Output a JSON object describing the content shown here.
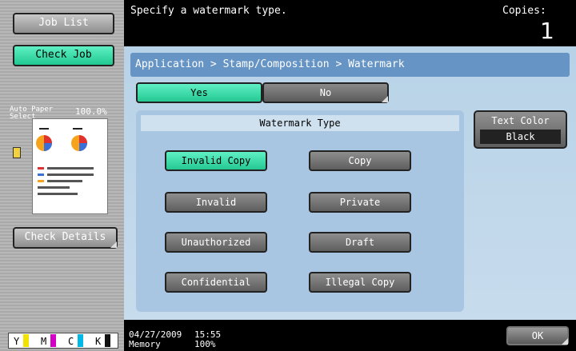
{
  "left": {
    "job_list": "Job List",
    "check_job": "Check Job",
    "auto_paper": "Auto Paper Select",
    "zoom": "100.0%",
    "check_details": "Check Details",
    "toner": [
      "Y",
      "M",
      "C",
      "K"
    ]
  },
  "header": {
    "instruction": "Specify a watermark type.",
    "copies_label": "Copies:",
    "copies_count": "1"
  },
  "main": {
    "breadcrumb": "Application > Stamp/Composition > Watermark",
    "yes_label": "Yes",
    "no_label": "No",
    "panel_title": "Watermark Type",
    "types": [
      "Invalid Copy",
      "Copy",
      "Invalid",
      "Private",
      "Unauthorized",
      "Draft",
      "Confidential",
      "Illegal Copy"
    ],
    "selected": "Invalid Copy",
    "text_color_label": "Text Color",
    "text_color_value": "Black"
  },
  "footer": {
    "date": "04/27/2009",
    "time": "15:55",
    "memory_label": "Memory",
    "memory_value": "100%",
    "ok_label": "OK"
  },
  "colors": {
    "accent": "#33dba8",
    "breadcrumb": "#6694c4",
    "panel": "#a8c6e2"
  }
}
